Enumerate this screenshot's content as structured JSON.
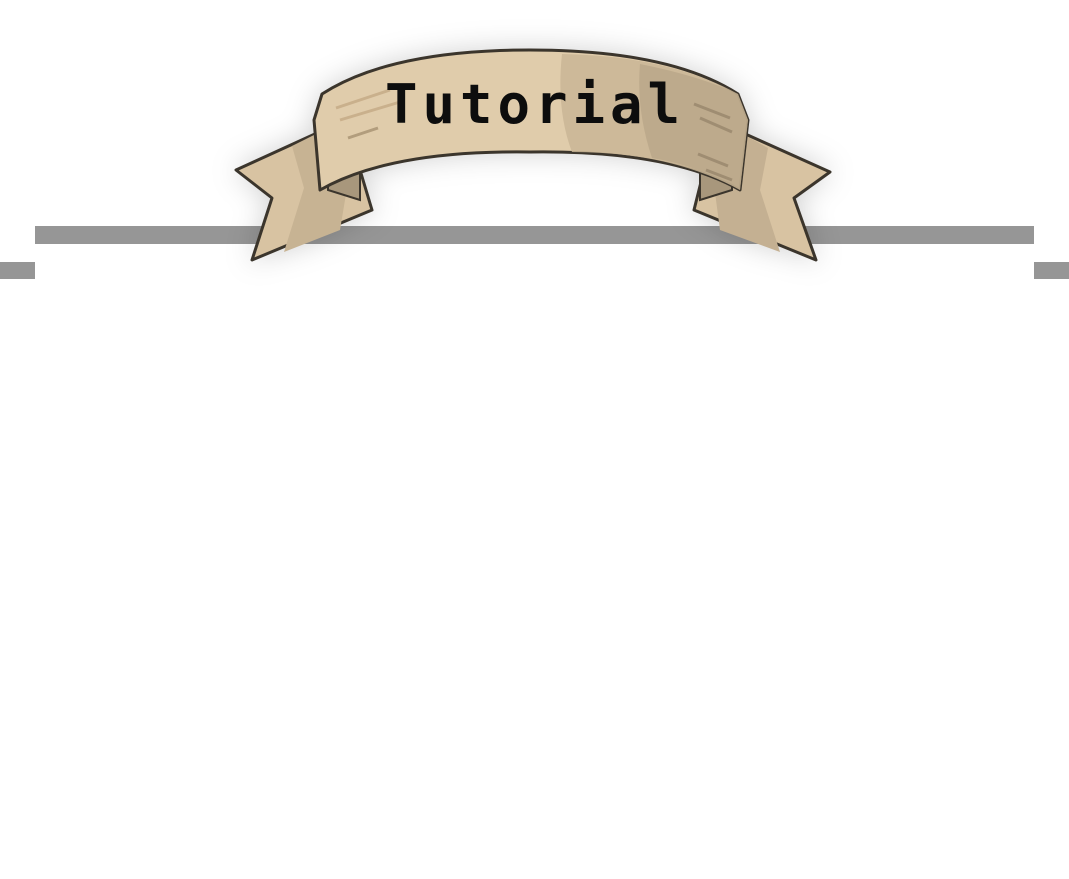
{
  "banner": {
    "title": "Tutorial"
  },
  "colors": {
    "background": "#ffffff",
    "frame": "#969696",
    "ribbon_light": "#e3cfb0",
    "ribbon_mid": "#d4bf9c",
    "ribbon_shadow": "#b8a68a",
    "ribbon_outline": "#3b352c",
    "title_text": "#0d0d0d"
  }
}
